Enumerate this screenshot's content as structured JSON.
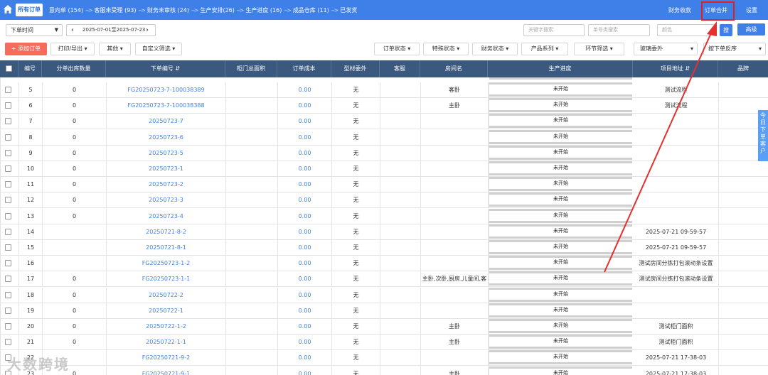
{
  "topbar": {
    "all_orders": "所有订单",
    "flow": [
      {
        "label": "意向单",
        "count": "(154)"
      },
      {
        "label": "客服未受理",
        "count": "(93)"
      },
      {
        "label": "财务未审核",
        "count": "(24)"
      },
      {
        "label": "生产安排",
        "count": "(26)"
      },
      {
        "label": "生产进度",
        "count": "(16)"
      },
      {
        "label": "成品仓库",
        "count": "(11)"
      },
      {
        "label": "已发货",
        "count": ""
      }
    ],
    "finance": "财务收款",
    "merge": "订单合并",
    "settings": "设置",
    "arrow_glyph": "-->"
  },
  "toolbar1": {
    "time_select": "下单时间",
    "date_range": "2025-07-01至2025-07-23",
    "prev": "‹",
    "next": "›",
    "keyword_placeholder": "关键字搜索",
    "order_no_placeholder": "单号类搜索",
    "color_placeholder": "颜色",
    "search_btn": "搜",
    "advanced_btn": "高级"
  },
  "toolbar2": {
    "add_order": "+ 添加订单",
    "print_export": "打印/导出",
    "other": "其他",
    "custom_filter": "自定义筛选",
    "order_status": "订单状态",
    "special_status": "特殊状态",
    "finance_status": "财务状态",
    "product_series": "产品系列",
    "stage_filter": "环节筛选",
    "glass_outsource": "玻璃委外",
    "sort": "按下单反序"
  },
  "table": {
    "headers": {
      "no": "编号",
      "split_qty": "分单出库数量",
      "order_no": "下单编号",
      "door_area": "柜门总面积",
      "cost": "订单成本",
      "profile": "型材委外",
      "customer": "客服",
      "room": "房间名",
      "progress": "生产进度",
      "address": "项目地址",
      "brand": "品牌"
    },
    "rows": [
      {
        "no": "5",
        "qty": "0",
        "order": "FG20250723-7-100038389",
        "cost": "0.00",
        "profile": "无",
        "room": "客卧",
        "progress": "未开始",
        "address": "测试流程"
      },
      {
        "no": "6",
        "qty": "0",
        "order": "FG20250723-7-100038388",
        "cost": "0.00",
        "profile": "无",
        "room": "主卧",
        "progress": "未开始",
        "address": "测试流程"
      },
      {
        "no": "7",
        "qty": "0",
        "order": "20250723-7",
        "cost": "0.00",
        "profile": "无",
        "room": "",
        "progress": "未开始",
        "address": ""
      },
      {
        "no": "8",
        "qty": "0",
        "order": "20250723-6",
        "cost": "0.00",
        "profile": "无",
        "room": "",
        "progress": "未开始",
        "address": ""
      },
      {
        "no": "9",
        "qty": "0",
        "order": "20250723-5",
        "cost": "0.00",
        "profile": "无",
        "room": "",
        "progress": "未开始",
        "address": ""
      },
      {
        "no": "10",
        "qty": "0",
        "order": "20250723-1",
        "cost": "0.00",
        "profile": "无",
        "room": "",
        "progress": "未开始",
        "address": ""
      },
      {
        "no": "11",
        "qty": "0",
        "order": "20250723-2",
        "cost": "0.00",
        "profile": "无",
        "room": "",
        "progress": "未开始",
        "address": ""
      },
      {
        "no": "12",
        "qty": "0",
        "order": "20250723-3",
        "cost": "0.00",
        "profile": "无",
        "room": "",
        "progress": "未开始",
        "address": ""
      },
      {
        "no": "13",
        "qty": "0",
        "order": "20250723-4",
        "cost": "0.00",
        "profile": "无",
        "room": "",
        "progress": "未开始",
        "address": ""
      },
      {
        "no": "14",
        "qty": "",
        "order": "20250721-8-2",
        "cost": "0.00",
        "profile": "无",
        "room": "",
        "progress": "未开始",
        "address": "2025-07-21 09-59-57"
      },
      {
        "no": "15",
        "qty": "",
        "order": "20250721-8-1",
        "cost": "0.00",
        "profile": "无",
        "room": "",
        "progress": "未开始",
        "address": "2025-07-21 09-59-57"
      },
      {
        "no": "16",
        "qty": "",
        "order": "FG20250723-1-2",
        "cost": "0.00",
        "profile": "无",
        "room": "",
        "progress": "未开始",
        "address": "测试房间分拣打包滚动条设置"
      },
      {
        "no": "17",
        "qty": "0",
        "order": "FG20250723-1-1",
        "cost": "0.00",
        "profile": "无",
        "room": "主卧,次卧,厨房,儿童间,客",
        "progress": "未开始",
        "address": "测试房间分拣打包滚动条设置"
      },
      {
        "no": "18",
        "qty": "0",
        "order": "20250722-2",
        "cost": "0.00",
        "profile": "无",
        "room": "",
        "progress": "未开始",
        "address": ""
      },
      {
        "no": "19",
        "qty": "0",
        "order": "20250722-1",
        "cost": "0.00",
        "profile": "无",
        "room": "",
        "progress": "未开始",
        "address": ""
      },
      {
        "no": "20",
        "qty": "0",
        "order": "20250722-1-2",
        "cost": "0.00",
        "profile": "无",
        "room": "主卧",
        "progress": "未开始",
        "address": "测试柜门面积"
      },
      {
        "no": "21",
        "qty": "0",
        "order": "20250722-1-1",
        "cost": "0.00",
        "profile": "无",
        "room": "主卧",
        "progress": "未开始",
        "address": "测试柜门面积"
      },
      {
        "no": "22",
        "qty": "",
        "order": "FG20250721-9-2",
        "cost": "0.00",
        "profile": "无",
        "room": "",
        "progress": "未开始",
        "address": "2025-07-21 17-38-03"
      },
      {
        "no": "23",
        "qty": "0",
        "order": "FG20250721-9-1",
        "cost": "0.00",
        "profile": "无",
        "room": "主卧",
        "progress": "未开始",
        "address": "2025-07-21 17-38-03"
      }
    ]
  },
  "side_tab": "今日下单客户",
  "watermark": "大数跨境",
  "colors": {
    "primary": "#3f7fe8",
    "header": "#3b587f",
    "danger": "#f56c5c",
    "annotation": "#e02020"
  }
}
